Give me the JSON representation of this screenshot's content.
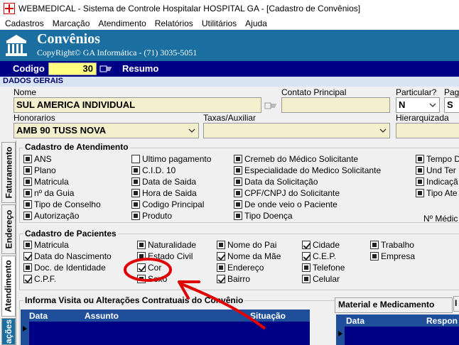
{
  "window": {
    "title": "WEBMEDICAL - Sistema de Controle Hospitalar HOSPITAL GA - [Cadastro de Convênios]"
  },
  "menu": [
    "Cadastros",
    "Marcação",
    "Atendimento",
    "Relatórios",
    "Utilitários",
    "Ajuda"
  ],
  "header": {
    "title": "Convênios",
    "subtitle": "CopyRight© GA Informática - (71) 3035-5051"
  },
  "codebar": {
    "codigo_label": "Codigo",
    "codigo_value": "30",
    "resumo_label": "Resumo"
  },
  "dados_gerais": {
    "section_label": "DADOS GERAIS",
    "nome_label": "Nome",
    "nome_value": "SUL AMERICA INDIVIDUAL",
    "contato_label": "Contato Principal",
    "contato_value": "",
    "particular_label": "Particular?",
    "particular_value": "N",
    "pag_label": "Pag",
    "pag_value": "S",
    "honorarios_label": "Honorarios",
    "honorarios_value": "AMB 90 TUSS NOVA",
    "taxas_label": "Taxas/Auxiliar",
    "taxas_value": "",
    "hierarquizada_label": "Hierarquizada",
    "hierarquizada_value": ""
  },
  "side_tabs": [
    "Faturamento",
    "Endereço",
    "Atendimento",
    "ações"
  ],
  "cadastro_atendimento": {
    "title": "Cadastro de Atendimento",
    "col1": [
      "ANS",
      "Plano",
      "Matricula",
      "nº da Guia",
      "Tipo de Conselho",
      "Autorização"
    ],
    "col2": [
      "Ultimo pagamento",
      "C.I.D. 10",
      "Data de Saida",
      "Hora de Saida",
      "Codigo Principal",
      "Produto"
    ],
    "col3": [
      "Cremeb do Médico Solicitante",
      "Especialidade do Medico Solicitante",
      "Data da Solicitação",
      "CPF/CNPJ do Solicitante",
      "De onde veio o Paciente",
      "Tipo Doença"
    ],
    "col4": [
      "Tempo D",
      "Und Ter",
      "Indicaçã",
      "Tipo Ate"
    ],
    "col4_extra": "Nº Médic"
  },
  "cadastro_pacientes": {
    "title": "Cadastro de Pacientes",
    "col1": [
      "Matricula",
      "Data do Nascimento",
      "Doc. de Identidade",
      "C.P.F."
    ],
    "col2": [
      "Naturalidade",
      "Estado Civil",
      "Cor",
      "Sexo"
    ],
    "col3": [
      "Nome do Pai",
      "Nome da Mãe",
      "Endereço",
      "Bairro"
    ],
    "col4": [
      "Cidade",
      "C.E.P.",
      "Telefone",
      "Celular"
    ],
    "col5": [
      "Trabalho",
      "Empresa"
    ]
  },
  "visitas": {
    "title": "Informa Visita ou Alterações Contratuais do Convênio",
    "columns": [
      "Data",
      "Assunto",
      "Situação"
    ]
  },
  "material": {
    "tab_label": "Material e Medicamento",
    "tab2_label": "I",
    "columns": [
      "Data",
      "Respon"
    ]
  },
  "colors": {
    "header_bg": "#1a6fa0",
    "codebar_bg": "#000084",
    "field_bg": "#f4efcd",
    "annotation": "#e00000"
  }
}
